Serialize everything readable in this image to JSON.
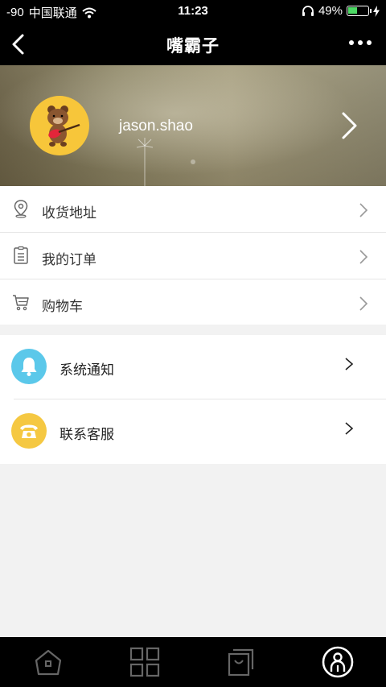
{
  "status_bar": {
    "signal": "-90",
    "carrier": "中国联通",
    "time": "11:23",
    "battery_percent": "49%",
    "battery_level": 0.49,
    "icons": [
      "wifi-icon",
      "headphones-icon",
      "battery-icon",
      "charging-icon"
    ]
  },
  "nav": {
    "title": "嘴霸子",
    "icons": [
      "back-arrow-icon",
      "more-dots-icon"
    ]
  },
  "profile": {
    "username": "jason.shao"
  },
  "menu_group_1": [
    {
      "label": "收货地址",
      "icon": "location-pin-icon"
    },
    {
      "label": "我的订单",
      "icon": "clipboard-icon"
    },
    {
      "label": "购物车",
      "icon": "cart-icon"
    }
  ],
  "menu_group_2": [
    {
      "label": "系统通知",
      "icon": "bell-icon",
      "color": "#5bc8ea"
    },
    {
      "label": "联系客服",
      "icon": "phone-icon",
      "color": "#f5c842"
    }
  ],
  "tab_bar": {
    "tabs": [
      "home-icon",
      "grid-icon",
      "shopping-bag-icon",
      "user-icon"
    ],
    "active_index": 3
  }
}
